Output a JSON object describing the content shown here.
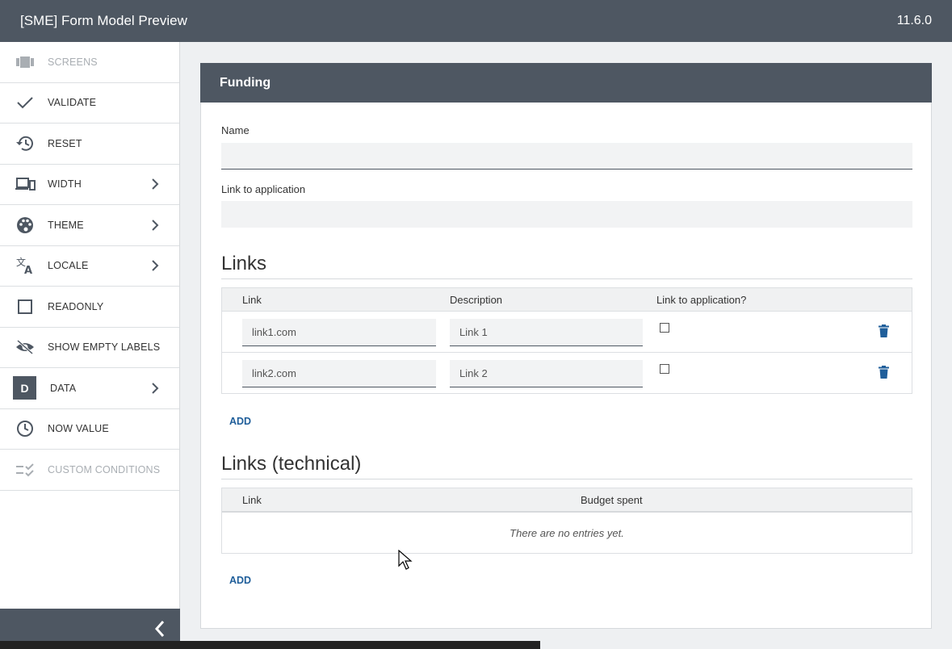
{
  "app": {
    "title": "[SME] Form Model Preview",
    "version": "11.6.0"
  },
  "sidebar": {
    "items": [
      {
        "label": "SCREENS",
        "icon": "screens-icon",
        "disabled": true
      },
      {
        "label": "VALIDATE",
        "icon": "check-icon"
      },
      {
        "label": "RESET",
        "icon": "history-icon"
      },
      {
        "label": "WIDTH",
        "icon": "devices-icon",
        "submenu": true
      },
      {
        "label": "THEME",
        "icon": "palette-icon",
        "submenu": true
      },
      {
        "label": "LOCALE",
        "icon": "translate-icon",
        "submenu": true
      },
      {
        "label": "READONLY",
        "icon": "checkbox-icon"
      },
      {
        "label": "SHOW EMPTY LABELS",
        "icon": "eye-off-icon"
      },
      {
        "label": "DATA",
        "icon": "data-icon",
        "badge": "D",
        "submenu": true
      },
      {
        "label": "NOW VALUE",
        "icon": "clock-icon"
      },
      {
        "label": "CUSTOM CONDITIONS",
        "icon": "conditions-icon",
        "disabled": true
      }
    ]
  },
  "form": {
    "title": "Funding",
    "name_label": "Name",
    "name_value": "",
    "link_label": "Link to application",
    "link_value": "",
    "links": {
      "title": "Links",
      "columns": [
        "Link",
        "Description",
        "Link to application?"
      ],
      "rows": [
        {
          "link": "link1.com",
          "description": "Link 1",
          "checked": false
        },
        {
          "link": "link2.com",
          "description": "Link 2",
          "checked": false
        }
      ],
      "add_label": "ADD"
    },
    "links_technical": {
      "title": "Links (technical)",
      "columns": [
        "Link",
        "Budget spent"
      ],
      "empty_text": "There are no entries yet.",
      "add_label": "ADD"
    }
  },
  "colors": {
    "header": "#4e5762",
    "accent": "#1f5e9a"
  }
}
